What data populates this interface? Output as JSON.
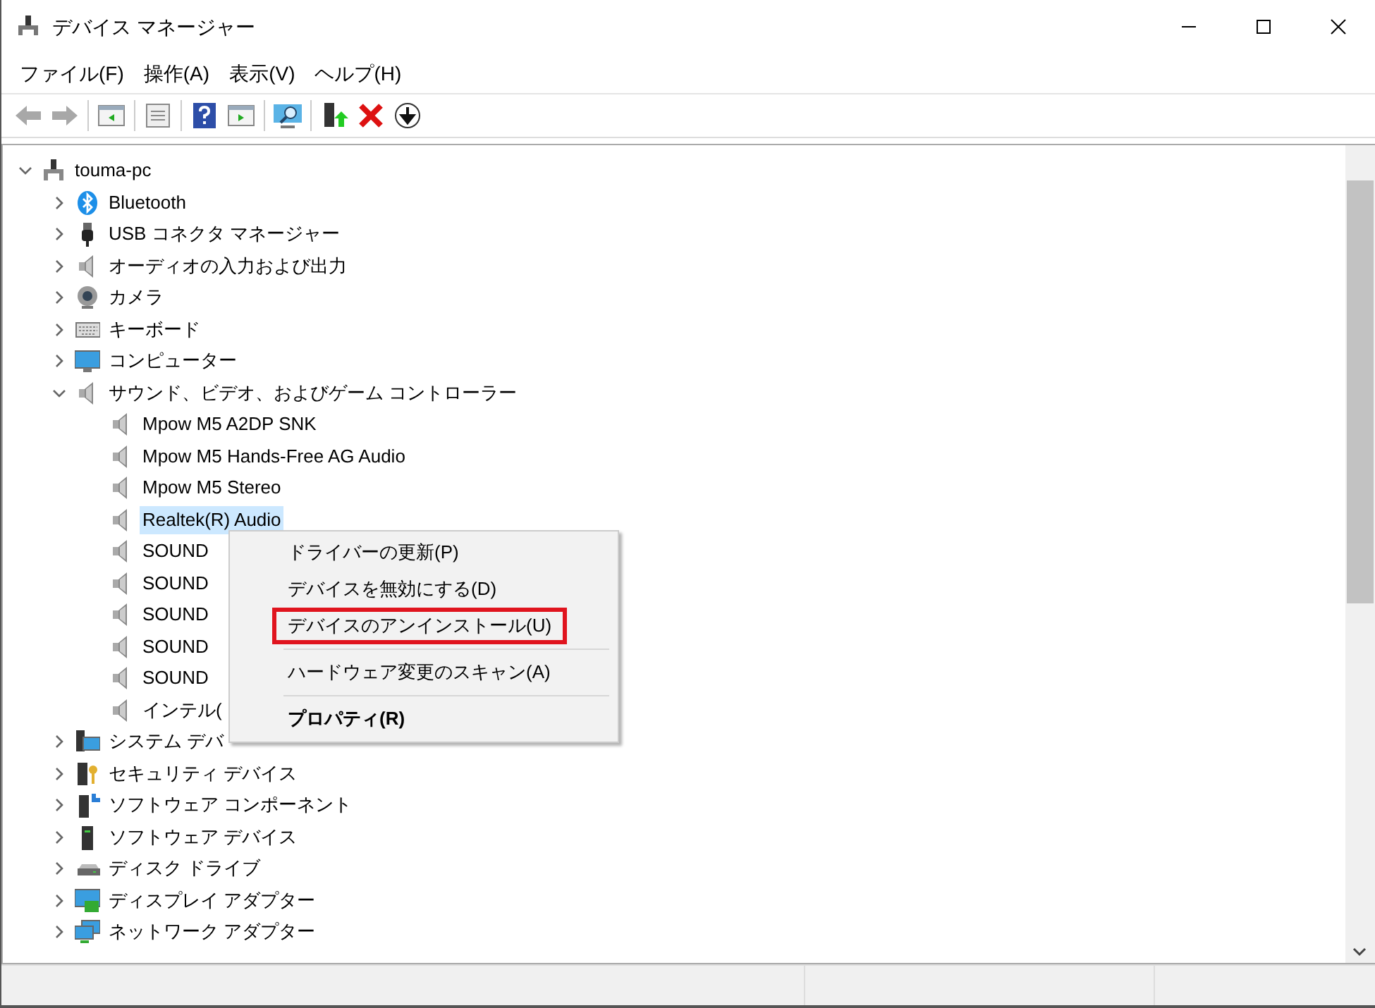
{
  "window": {
    "title": "デバイス マネージャー"
  },
  "menu_bar": [
    {
      "label": "ファイル(F)"
    },
    {
      "label": "操作(A)"
    },
    {
      "label": "表示(V)"
    },
    {
      "label": "ヘルプ(H)"
    }
  ],
  "tree": [
    {
      "label": "touma-pc",
      "kind": "computer-root",
      "expanded": true,
      "selected": false,
      "children": [
        {
          "label": "Bluetooth",
          "kind": "bluetooth",
          "expanded": false,
          "selected": false
        },
        {
          "label": "USB コネクタ マネージャー",
          "kind": "usb",
          "expanded": false,
          "selected": false
        },
        {
          "label": "オーディオの入力および出力",
          "kind": "speaker",
          "expanded": false,
          "selected": false
        },
        {
          "label": "カメラ",
          "kind": "camera",
          "expanded": false,
          "selected": false
        },
        {
          "label": "キーボード",
          "kind": "keyboard",
          "expanded": false,
          "selected": false
        },
        {
          "label": "コンピューター",
          "kind": "monitor",
          "expanded": false,
          "selected": false
        },
        {
          "label": "サウンド、ビデオ、およびゲーム コントローラー",
          "kind": "speaker",
          "expanded": true,
          "selected": false,
          "children": [
            {
              "label": "Mpow M5 A2DP SNK",
              "kind": "speaker",
              "selected": false
            },
            {
              "label": "Mpow M5 Hands-Free AG Audio",
              "kind": "speaker",
              "selected": false
            },
            {
              "label": "Mpow M5 Stereo",
              "kind": "speaker",
              "selected": false
            },
            {
              "label": "Realtek(R) Audio",
              "kind": "speaker",
              "selected": true
            },
            {
              "label": "SOUND",
              "kind": "speaker",
              "selected": false
            },
            {
              "label": "SOUND",
              "kind": "speaker",
              "selected": false
            },
            {
              "label": "SOUND",
              "kind": "speaker",
              "selected": false
            },
            {
              "label": "SOUND",
              "kind": "speaker",
              "selected": false
            },
            {
              "label": "SOUND",
              "kind": "speaker",
              "selected": false
            },
            {
              "label": "インテル(",
              "kind": "speaker",
              "selected": false
            }
          ]
        },
        {
          "label": "システム デバ",
          "kind": "system",
          "expanded": false,
          "selected": false
        },
        {
          "label": "セキュリティ デバイス",
          "kind": "security",
          "expanded": false,
          "selected": false
        },
        {
          "label": "ソフトウェア コンポーネント",
          "kind": "component",
          "expanded": false,
          "selected": false
        },
        {
          "label": "ソフトウェア デバイス",
          "kind": "tower",
          "expanded": false,
          "selected": false
        },
        {
          "label": "ディスク ドライブ",
          "kind": "disk",
          "expanded": false,
          "selected": false
        },
        {
          "label": "ディスプレイ アダプター",
          "kind": "display",
          "expanded": false,
          "selected": false
        },
        {
          "label": "ネットワーク アダプター",
          "kind": "network",
          "expanded": false,
          "selected": false
        }
      ]
    }
  ],
  "context_menu": [
    {
      "kind": "item",
      "label": "ドライバーの更新(P)",
      "bold": false,
      "marked": false
    },
    {
      "kind": "item",
      "label": "デバイスを無効にする(D)",
      "bold": false,
      "marked": false
    },
    {
      "kind": "item",
      "label": "デバイスのアンインストール(U)",
      "bold": false,
      "marked": true
    },
    {
      "kind": "separator"
    },
    {
      "kind": "item",
      "label": "ハードウェア変更のスキャン(A)",
      "bold": false,
      "marked": false
    },
    {
      "kind": "separator"
    },
    {
      "kind": "item",
      "label": "プロパティ(R)",
      "bold": true,
      "marked": false
    }
  ]
}
